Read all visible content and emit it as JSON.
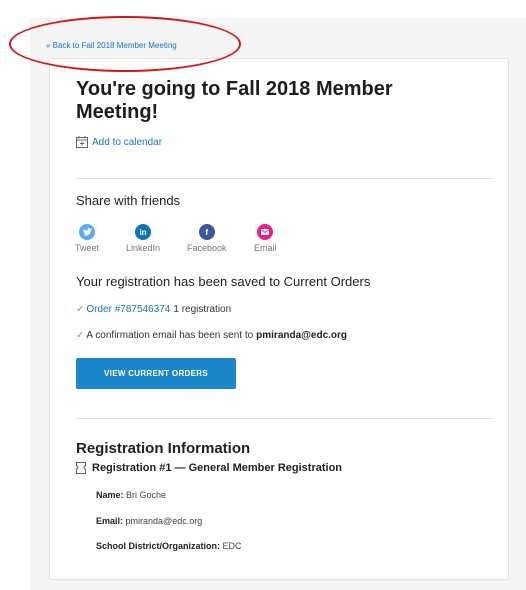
{
  "back_link": "« Back to Fall 2018 Member Meeting",
  "title": "You're going to Fall 2018 Member Meeting!",
  "add_to_calendar": "Add to calendar",
  "share": {
    "heading": "Share with friends",
    "items": [
      {
        "label": "Tweet",
        "icon": "twitter-icon",
        "color": "#55acee",
        "glyph": "t"
      },
      {
        "label": "LinkedIn",
        "icon": "linkedin-icon",
        "color": "#0a77b5",
        "glyph": "in"
      },
      {
        "label": "Facebook",
        "icon": "facebook-icon",
        "color": "#3b5998",
        "glyph": "f"
      },
      {
        "label": "Email",
        "icon": "email-icon",
        "color": "#e91e8c",
        "glyph": "✉"
      }
    ]
  },
  "saved_message": "Your registration has been saved to Current Orders",
  "order": {
    "link": "Order #787546374",
    "suffix": "1 registration"
  },
  "confirmation": {
    "text": "A confirmation email has been sent to",
    "email": "pmiranda@edc.org"
  },
  "view_orders_button": "VIEW CURRENT ORDERS",
  "registration": {
    "heading": "Registration Information",
    "subheading": "Registration #1 — General Member Registration",
    "fields": [
      {
        "label": "Name:",
        "value": "Bri Goche"
      },
      {
        "label": "Email:",
        "value": "pmiranda@edc.org"
      },
      {
        "label": "School District/Organization:",
        "value": "EDC"
      }
    ]
  },
  "colors": {
    "link": "#1a73c6",
    "button": "#1b86c8",
    "check": "#5fb35f",
    "annotation": "#d0181b"
  }
}
